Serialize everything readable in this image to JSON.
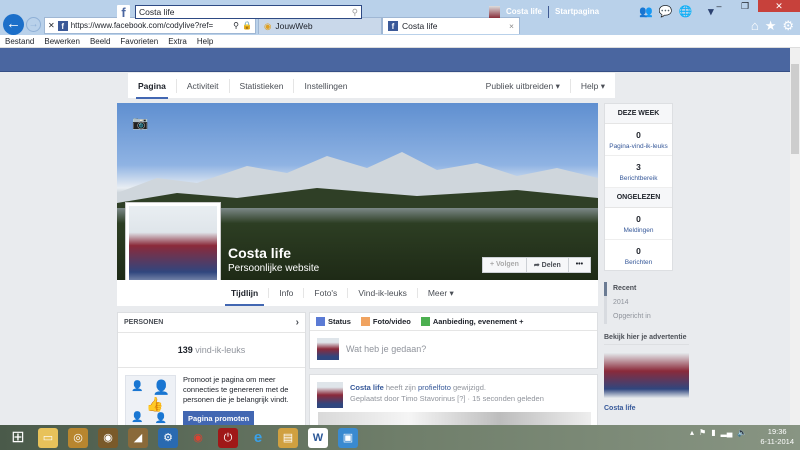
{
  "browser": {
    "url": "https://www.facebook.com/codylive?ref=",
    "tabs": [
      {
        "label": "JouwWeb"
      },
      {
        "label": "Costa life",
        "close": "×"
      }
    ],
    "menu": [
      "Bestand",
      "Bewerken",
      "Beeld",
      "Favorieten",
      "Extra",
      "Help"
    ]
  },
  "fb": {
    "search_value": "Costa life",
    "user": "Costa life",
    "home": "Startpagina"
  },
  "pagenav": {
    "items": [
      "Pagina",
      "Activiteit",
      "Statistieken",
      "Instellingen"
    ],
    "right": [
      "Publiek uitbreiden ▾",
      "Help ▾"
    ]
  },
  "profile": {
    "name": "Costa life",
    "category": "Persoonlijke website",
    "follow": "+ Volgen",
    "share": "➦ Delen",
    "more": "•••",
    "tabs": [
      "Tijdlijn",
      "Info",
      "Foto's",
      "Vind-ik-leuks",
      "Meer ▾"
    ]
  },
  "persons": {
    "title": "PERSONEN",
    "likes_count": "139",
    "likes_label": "vind-ik-leuks",
    "promo_text": "Promoot je pagina om meer connecties te genereren met de personen die je belangrijk vindt.",
    "promo_button": "Pagina promoten"
  },
  "composer": {
    "tabs": [
      "Status",
      "Foto/video",
      "Aanbieding, evenement +"
    ],
    "placeholder": "Wat heb je gedaan?"
  },
  "post": {
    "author": "Costa life",
    "action": "heeft zijn",
    "link": "profielfoto",
    "action_end": "gewijzigd.",
    "meta": "Geplaatst door Timo Stavorinus [?] · 15 seconden geleden"
  },
  "stats": {
    "week_title": "DEZE WEEK",
    "week": [
      {
        "value": "0",
        "label": "Pagina-vind-ik-leuks"
      },
      {
        "value": "3",
        "label": "Berichtbereik"
      }
    ],
    "unread_title": "ONGELEZEN",
    "unread": [
      {
        "value": "0",
        "label": "Meldingen"
      },
      {
        "value": "0",
        "label": "Berichten"
      }
    ]
  },
  "timeline": [
    "Recent",
    "2014",
    "Opgericht in"
  ],
  "ad": {
    "title": "Bekijk hier je advertentie",
    "name": "Costa life"
  },
  "clock": {
    "time": "19:36",
    "date": "6-11-2014"
  }
}
